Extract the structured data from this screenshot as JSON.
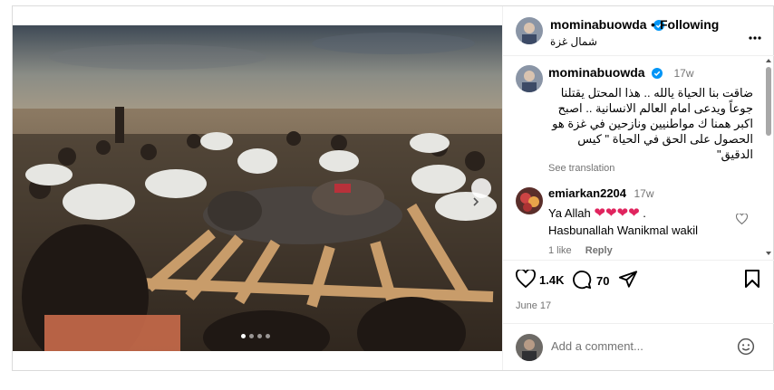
{
  "post": {
    "author": "mominabuowda",
    "follow_label": "Following",
    "location": "شمال غزة",
    "caption_author": "mominabuowda",
    "caption_time": "17w",
    "caption_lines": [
      "ضاقت بنا الحياة يالله .. هذا المحتل يقتلنا",
      "جوعاً ويدعى امام العالم الانسانية .. اصبح",
      "اكبر همنا ك مواطنيين ونازحين في غزة هو",
      "الحصول على الحق في الحياة \" كيس",
      "الدقيق\""
    ],
    "see_translation": "See translation",
    "comment": {
      "author": "emiarkan2204",
      "time": "17w",
      "line1": "Ya Allah",
      "line2": "Hasbunallah Wanikmal wakil",
      "likes": "1 like",
      "reply": "Reply"
    },
    "likes": "1.4K",
    "comments_count": "70",
    "date": "June 17",
    "add_comment_placeholder": "Add a comment...",
    "carousel": {
      "slides": 4,
      "active": 0
    }
  },
  "icons": {
    "verified": "verified-badge-icon",
    "more": "more-options-icon",
    "like": "heart-icon",
    "comment": "comment-icon",
    "share": "share-icon",
    "save": "bookmark-icon",
    "emoji": "emoji-icon",
    "next": "chevron-right-icon",
    "comment_like": "small-heart-icon"
  },
  "colors": {
    "verified": "#0095f6",
    "heart": "#e0245e",
    "muted": "#737373"
  }
}
